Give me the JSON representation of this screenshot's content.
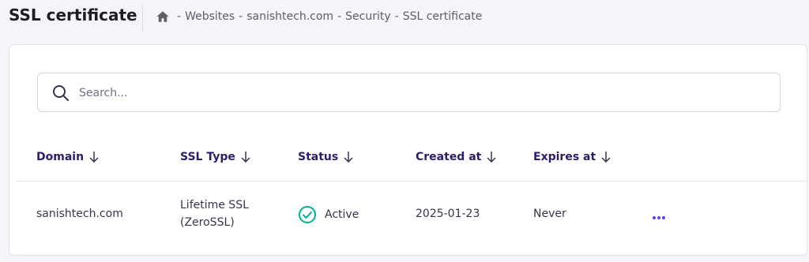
{
  "header": {
    "title": "SSL certificate",
    "breadcrumb": {
      "home_icon": "home-icon",
      "separator": "-",
      "items": [
        "Websites",
        "sanishtech.com",
        "Security",
        "SSL certificate"
      ]
    }
  },
  "search": {
    "placeholder": "Search...",
    "value": "",
    "icon": "search-icon"
  },
  "table": {
    "columns": [
      {
        "label": "Domain",
        "sort_icon": "arrow-down-icon"
      },
      {
        "label": "SSL Type",
        "sort_icon": "arrow-down-icon"
      },
      {
        "label": "Status",
        "sort_icon": "arrow-down-icon"
      },
      {
        "label": "Created at",
        "sort_icon": "arrow-down-icon"
      },
      {
        "label": "Expires at",
        "sort_icon": "arrow-down-icon"
      }
    ],
    "rows": [
      {
        "domain": "sanishtech.com",
        "ssl_type_line1": "Lifetime SSL",
        "ssl_type_line2": "(ZeroSSL)",
        "status": "Active",
        "status_icon": "check-circle-icon",
        "created_at": "2025-01-23",
        "expires_at": "Never",
        "actions_icon": "more-horizontal-icon"
      }
    ]
  },
  "colors": {
    "background": "#f4f4fb",
    "accent": "#673de6",
    "header_text": "#2f1c6a",
    "status_active": "#00b090"
  }
}
